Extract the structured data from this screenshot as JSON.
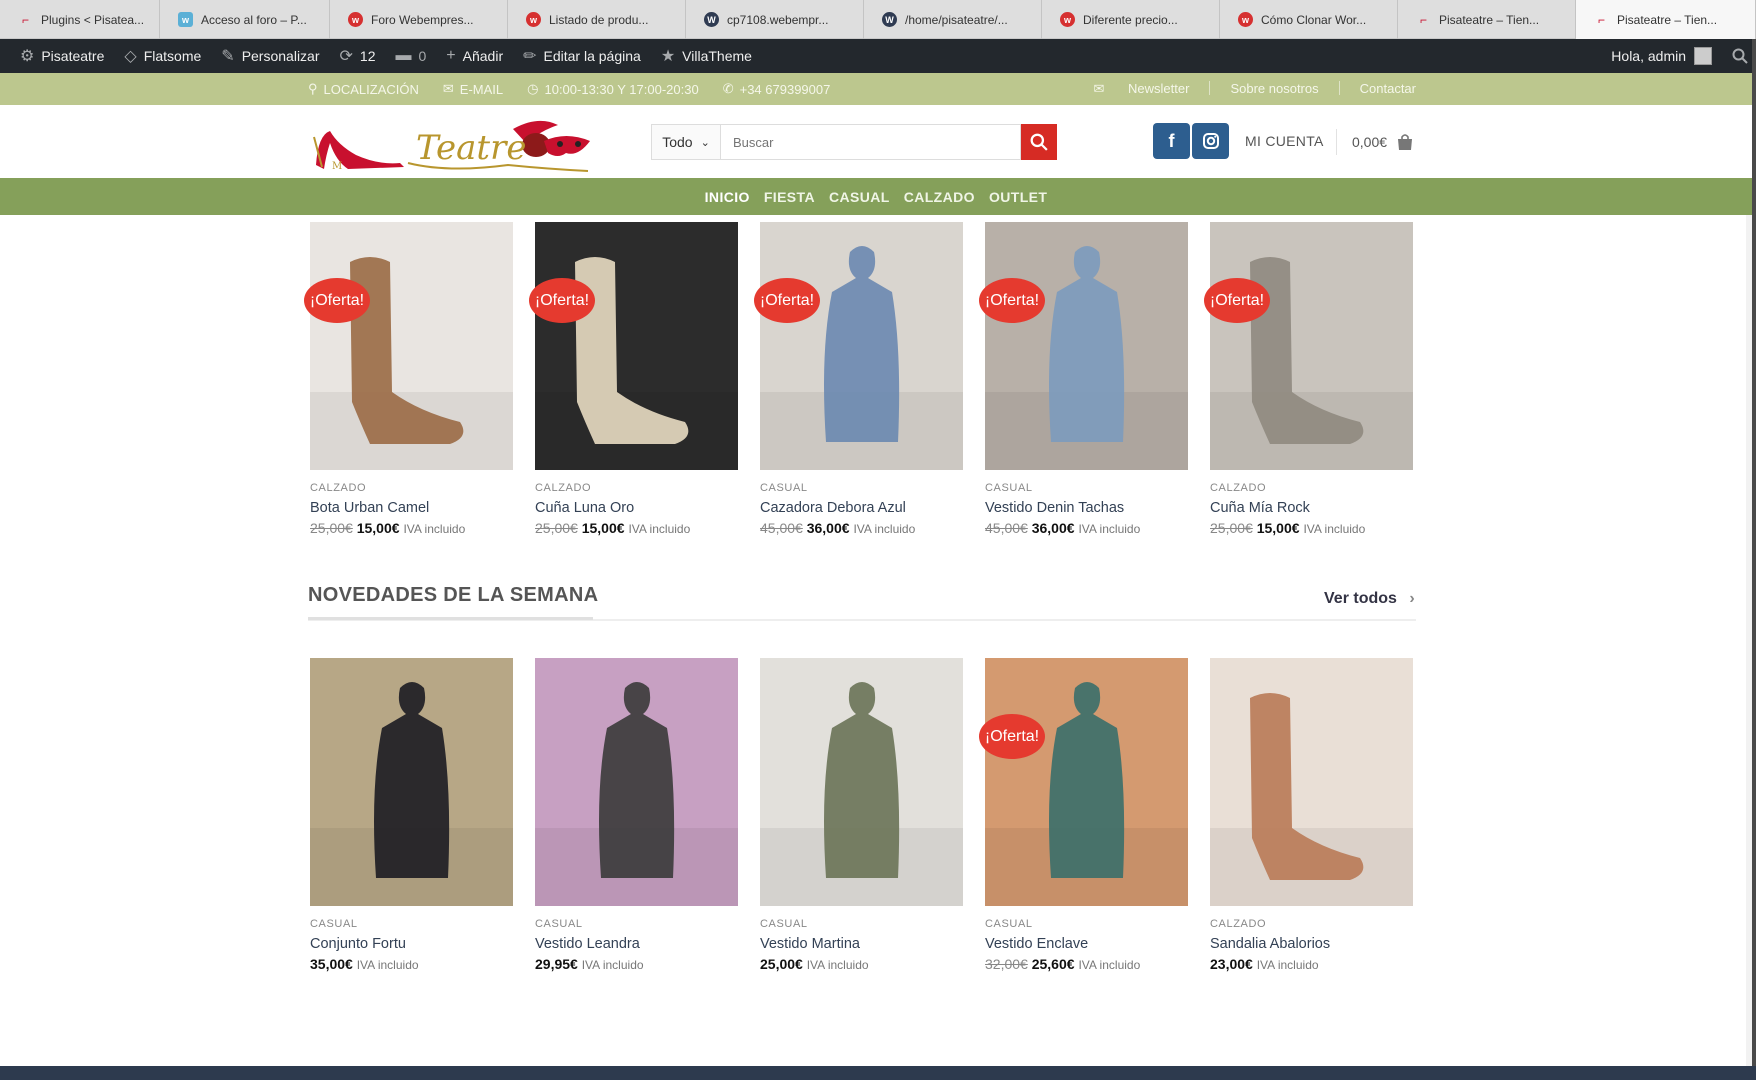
{
  "tabs": [
    {
      "label": "Plugins < Pisatea...",
      "icon": "heel",
      "width": 160
    },
    {
      "label": "Acceso al foro – P...",
      "icon": "blue",
      "width": 170
    },
    {
      "label": "Foro Webempres...",
      "icon": "red",
      "width": 178
    },
    {
      "label": "Listado de produ...",
      "icon": "red",
      "width": 178
    },
    {
      "label": "cp7108.webempr...",
      "icon": "wp",
      "width": 178
    },
    {
      "label": "/home/pisateatre/...",
      "icon": "wp",
      "width": 178
    },
    {
      "label": "Diferente precio...",
      "icon": "red",
      "width": 178
    },
    {
      "label": "Cómo Clonar Wor...",
      "icon": "red",
      "width": 178
    },
    {
      "label": "Pisateatre – Tien...",
      "icon": "heel",
      "width": 178
    },
    {
      "label": "Pisateatre – Tien...",
      "icon": "heel",
      "width": 180,
      "active": true
    }
  ],
  "adminbar": {
    "site": "Pisateatre",
    "theme": "Flatsome",
    "customize": "Personalizar",
    "updates": "12",
    "comments": "0",
    "add": "Añadir",
    "edit": "Editar la página",
    "villa": "VillaTheme",
    "greeting": "Hola, admin"
  },
  "topbar": {
    "location": "LOCALIZACIÓN",
    "email": "E-MAIL",
    "hours": "10:00-13:30 Y 17:00-20:30",
    "phone": "+34 679399007",
    "newsletter": "Newsletter",
    "about": "Sobre nosotros",
    "contact": "Contactar"
  },
  "header": {
    "logo_text": "Teatre",
    "search_select": "Todo",
    "search_placeholder": "Buscar",
    "account": "MI CUENTA",
    "cart": "0,00€"
  },
  "nav": [
    "INICIO",
    "FIESTA",
    "CASUAL",
    "CALZADO",
    "OUTLET"
  ],
  "sale_badge": "¡Oferta!",
  "iva": "IVA incluido",
  "row1": [
    {
      "cat": "CALZADO",
      "name": "Bota Urban Camel",
      "old": "25,00€",
      "price": "15,00€",
      "sale": true,
      "bg": "#e9e5e1",
      "fg": "#9a6a45"
    },
    {
      "cat": "CALZADO",
      "name": "Cuña Luna Oro",
      "old": "25,00€",
      "price": "15,00€",
      "sale": true,
      "bg": "#2c2c2c",
      "fg": "#e8dcc2"
    },
    {
      "cat": "CASUAL",
      "name": "Cazadora Debora Azul",
      "old": "45,00€",
      "price": "36,00€",
      "sale": true,
      "bg": "#d9d5cf",
      "fg": "#6a88b0"
    },
    {
      "cat": "CASUAL",
      "name": "Vestido Denin Tachas",
      "old": "45,00€",
      "price": "36,00€",
      "sale": true,
      "bg": "#b8b0a8",
      "fg": "#7c9bbd"
    },
    {
      "cat": "CALZADO",
      "name": "Cuña Mía Rock",
      "old": "25,00€",
      "price": "15,00€",
      "sale": true,
      "bg": "#c9c4bd",
      "fg": "#8f8a80"
    }
  ],
  "section": {
    "title": "NOVEDADES DE LA SEMANA",
    "view_all": "Ver todos"
  },
  "row2": [
    {
      "cat": "CASUAL",
      "name": "Conjunto Fortu",
      "old": "",
      "price": "35,00€",
      "sale": false,
      "bg": "#b7a786",
      "fg": "#1c1c22"
    },
    {
      "cat": "CASUAL",
      "name": "Vestido Leandra",
      "old": "",
      "price": "29,95€",
      "sale": false,
      "bg": "#c7a0c2",
      "fg": "#3a3a3a"
    },
    {
      "cat": "CASUAL",
      "name": "Vestido Martina",
      "old": "",
      "price": "25,00€",
      "sale": false,
      "bg": "#e2e0db",
      "fg": "#6a7356"
    },
    {
      "cat": "CASUAL",
      "name": "Vestido Enclave",
      "old": "32,00€",
      "price": "25,60€",
      "sale": true,
      "bg": "#d49a70",
      "fg": "#3a6f6a"
    },
    {
      "cat": "CALZADO",
      "name": "Sandalia Abalorios",
      "old": "",
      "price": "23,00€",
      "sale": false,
      "bg": "#e9dfd6",
      "fg": "#b97a57"
    }
  ]
}
